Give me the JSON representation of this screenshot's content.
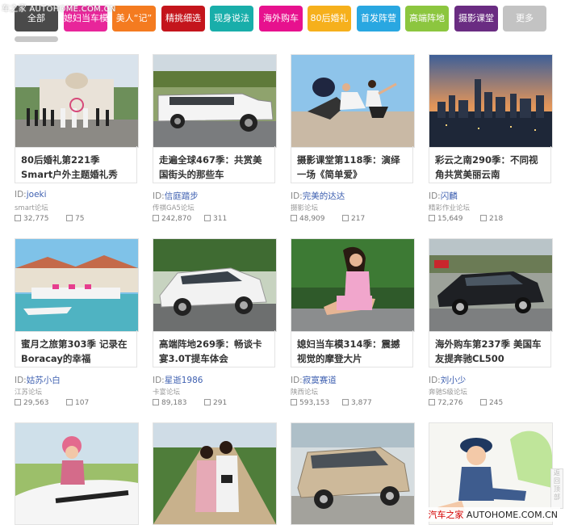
{
  "watermark_top": "车之家 AUTOHOME.COM.CN",
  "watermark_bottom_red": "汽车之家",
  "watermark_bottom_text": " AUTOHOME.COM.CN",
  "side_widget_label": "返回顶部",
  "tabs": [
    {
      "label": "全部",
      "color": "#4a4a4a"
    },
    {
      "label": "媳妇当车模",
      "color": "#e8259a"
    },
    {
      "label": "美人“记”",
      "color": "#f47b20"
    },
    {
      "label": "精挑细选",
      "color": "#c4151c"
    },
    {
      "label": "现身说法",
      "color": "#19aeaa"
    },
    {
      "label": "海外购车",
      "color": "#e7118e"
    },
    {
      "label": "80后婚礼",
      "color": "#f6b01c"
    },
    {
      "label": "首发阵营",
      "color": "#29a7e1"
    },
    {
      "label": "高端阵地",
      "color": "#8cc63f"
    },
    {
      "label": "摄影课堂",
      "color": "#6a2c82"
    },
    {
      "label": "更多",
      "color": "#c3c3c3"
    }
  ],
  "cards": [
    {
      "title": "80后婚礼第221季 Smart户外主题婚礼秀",
      "id_prefix": "ID:",
      "user": "joeki",
      "forum": "smart论坛",
      "views": "32,775",
      "comments": "75"
    },
    {
      "title": "走遍全球467季：共赏美国街头的那些车",
      "id_prefix": "ID:",
      "user": "信庭踏步",
      "forum": "传祺GA5论坛",
      "views": "242,870",
      "comments": "311"
    },
    {
      "title": "摄影课堂第118季：演绎一场《简单爱》",
      "id_prefix": "ID:",
      "user": "完美的达达",
      "forum": "摄影论坛",
      "views": "48,909",
      "comments": "217"
    },
    {
      "title": "彩云之南290季：不同视角共赏美丽云南",
      "id_prefix": "ID:",
      "user": "闪麟",
      "forum": "精彩作业论坛",
      "views": "15,649",
      "comments": "218"
    },
    {
      "title": "蜜月之旅第303季 记录在Boracay的幸福",
      "id_prefix": "ID:",
      "user": "姑苏小白",
      "forum": "江苏论坛",
      "views": "29,563",
      "comments": "107"
    },
    {
      "title": "高端阵地269季：畅谈卡宴3.0T提车体会",
      "id_prefix": "ID:",
      "user": "星逝1986",
      "forum": "卡宴论坛",
      "views": "89,183",
      "comments": "291"
    },
    {
      "title": "媳妇当车模314季：震撼视觉的摩登大片",
      "id_prefix": "ID:",
      "user": "寂寞赛道",
      "forum": "陕西论坛",
      "views": "593,153",
      "comments": "3,877"
    },
    {
      "title": "海外购车第237季 美国车友提奔驰CL500",
      "id_prefix": "ID:",
      "user": "刘小少",
      "forum": "奔驰S级论坛",
      "views": "72,276",
      "comments": "245"
    },
    {
      "title": "",
      "id_prefix": "",
      "user": "",
      "forum": "",
      "views": "",
      "comments": ""
    },
    {
      "title": "",
      "id_prefix": "",
      "user": "",
      "forum": "",
      "views": "",
      "comments": ""
    },
    {
      "title": "",
      "id_prefix": "",
      "user": "",
      "forum": "",
      "views": "",
      "comments": ""
    },
    {
      "title": "",
      "id_prefix": "",
      "user": "",
      "forum": "",
      "views": "",
      "comments": ""
    }
  ],
  "icons": {
    "views": "document-icon",
    "comments": "comment-icon"
  }
}
